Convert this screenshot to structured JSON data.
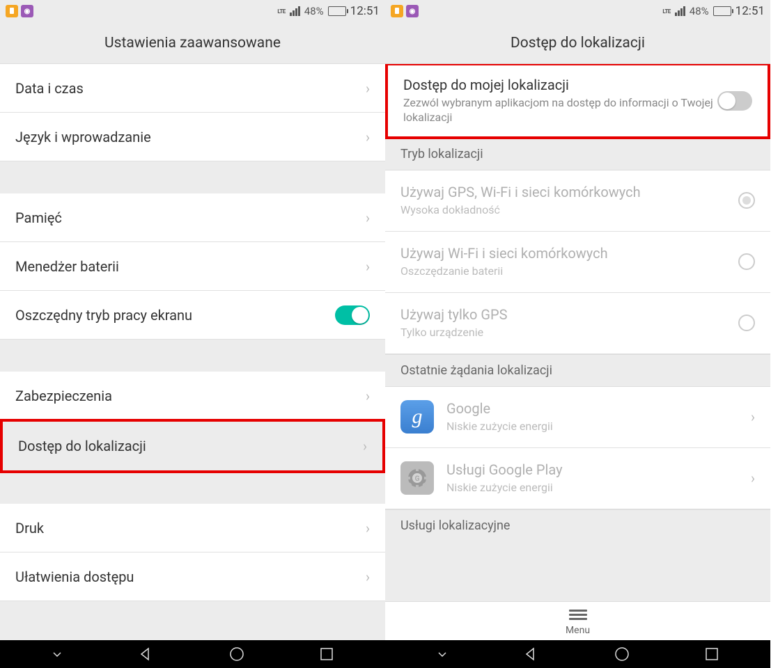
{
  "status": {
    "lte": "LTE",
    "battery_pct": "48%",
    "time": "12:51"
  },
  "left": {
    "title": "Ustawienia zaawansowane",
    "rows": {
      "date_time": "Data i czas",
      "language": "Język i wprowadzanie",
      "storage": "Pamięć",
      "battery_mgr": "Menedżer baterii",
      "screen_power": "Oszczędny tryb pracy ekranu",
      "security": "Zabezpieczenia",
      "location": "Dostęp do lokalizacji",
      "print": "Druk",
      "accessibility": "Ułatwienia dostępu"
    }
  },
  "right": {
    "title": "Dostęp do lokalizacji",
    "my_location": {
      "title": "Dostęp do mojej lokalizacji",
      "subtitle": "Zezwól wybranym aplikacjom na dostęp do informacji o Twojej lokalizacji"
    },
    "section_mode": "Tryb lokalizacji",
    "modes": {
      "gps_wifi_cell": {
        "title": "Używaj GPS, Wi-Fi i sieci komórkowych",
        "subtitle": "Wysoka dokładność"
      },
      "wifi_cell": {
        "title": "Używaj Wi-Fi i sieci komórkowych",
        "subtitle": "Oszczędzanie baterii"
      },
      "gps_only": {
        "title": "Używaj tylko GPS",
        "subtitle": "Tylko urządzenie"
      }
    },
    "section_recent": "Ostatnie żądania lokalizacji",
    "apps": {
      "google": {
        "title": "Google",
        "subtitle": "Niskie zużycie energii"
      },
      "play_services": {
        "title": "Usługi Google Play",
        "subtitle": "Niskie zużycie energii"
      }
    },
    "section_services": "Usługi lokalizacyjne",
    "menu_label": "Menu"
  }
}
